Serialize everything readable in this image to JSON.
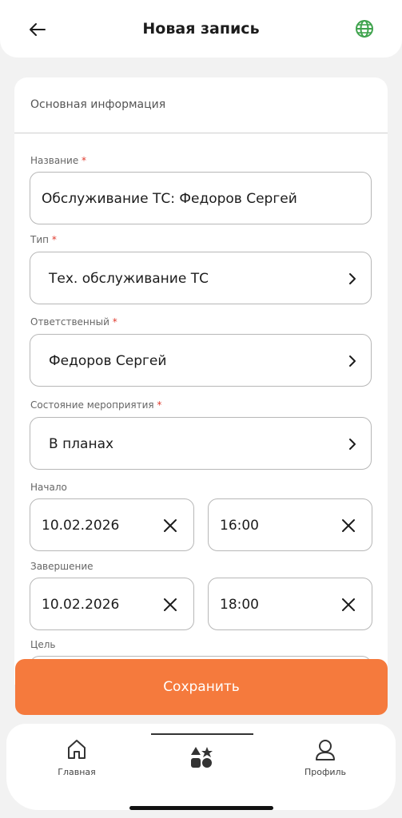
{
  "header": {
    "title": "Новая запись",
    "back_icon": "arrow-left-icon",
    "globe_icon": "globe-icon",
    "globe_color": "#3fa34d"
  },
  "section": {
    "title": "Основная информация"
  },
  "form": {
    "required_mark": "*",
    "name": {
      "label": "Название",
      "value": "Обслуживание ТС: Федоров Сергей"
    },
    "type": {
      "label": "Тип",
      "value": "Тех. обслуживание ТС"
    },
    "responsible": {
      "label": "Ответственный",
      "value": "Федоров Сергей"
    },
    "state": {
      "label": "Состояние мероприятия",
      "value": "В планах"
    },
    "start": {
      "label": "Начало",
      "date": "10.02.2026",
      "time": "16:00"
    },
    "end": {
      "label": "Завершение",
      "date": "10.02.2026",
      "time": "18:00"
    },
    "goal": {
      "label": "Цель"
    }
  },
  "actions": {
    "save_label": "Сохранить",
    "save_color": "#f57a3d"
  },
  "tabbar": {
    "items": [
      {
        "label": "Главная",
        "icon": "home-icon"
      },
      {
        "label": "",
        "icon": "categories-icon"
      },
      {
        "label": "Профиль",
        "icon": "profile-icon"
      }
    ]
  }
}
